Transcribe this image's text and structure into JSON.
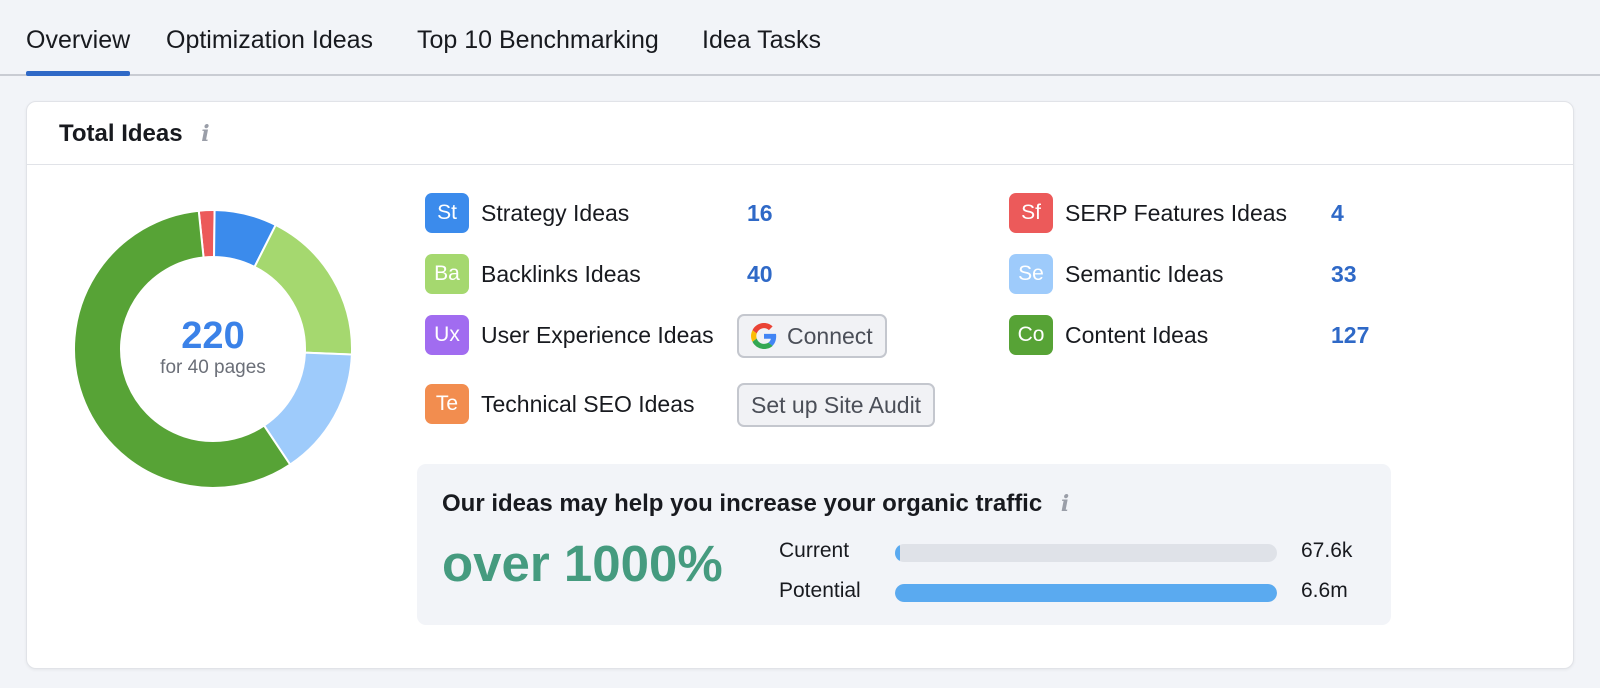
{
  "tabs": [
    {
      "label": "Overview",
      "active": true
    },
    {
      "label": "Optimization Ideas",
      "active": false
    },
    {
      "label": "Top 10 Benchmarking",
      "active": false
    },
    {
      "label": "Idea Tasks",
      "active": false
    }
  ],
  "card": {
    "title": "Total Ideas",
    "info_icon": "i"
  },
  "donut": {
    "total": "220",
    "subtitle": "for 40 pages"
  },
  "chart_data": {
    "type": "pie",
    "categories": [
      "Strategy Ideas",
      "Backlinks Ideas",
      "Semantic Ideas",
      "Content Ideas",
      "SERP Features Ideas"
    ],
    "values": [
      16,
      40,
      33,
      127,
      4
    ],
    "colors": [
      "#3b8bec",
      "#a5d86f",
      "#9ecbfb",
      "#57a336",
      "#ec5a5a"
    ],
    "total": 220
  },
  "ideas": [
    {
      "abbr": "St",
      "label": "Strategy Ideas",
      "count": "16",
      "color": "#3b8bec"
    },
    {
      "abbr": "Ba",
      "label": "Backlinks Ideas",
      "count": "40",
      "color": "#a5d86f"
    },
    {
      "abbr": "Ux",
      "label": "User Experience Ideas",
      "color": "#a16cf0",
      "button": "Connect",
      "button_icon": "google-icon"
    },
    {
      "abbr": "Te",
      "label": "Technical SEO Ideas",
      "color": "#f28d4f",
      "button": "Set up Site Audit"
    },
    {
      "abbr": "Sf",
      "label": "SERP Features Ideas",
      "count": "4",
      "color": "#ec5a5a"
    },
    {
      "abbr": "Se",
      "label": "Semantic Ideas",
      "count": "33",
      "color": "#9ecbfb"
    },
    {
      "abbr": "Co",
      "label": "Content Ideas",
      "count": "127",
      "color": "#57a336"
    }
  ],
  "traffic": {
    "title": "Our ideas may help you increase your organic traffic",
    "info_icon": "i",
    "headline": "over 1000%",
    "bars": [
      {
        "label": "Current",
        "value": "67.6k",
        "fill": 0.01,
        "color": "#5aaaf0"
      },
      {
        "label": "Potential",
        "value": "6.6m",
        "fill": 1.0,
        "color": "#5aaaf0"
      }
    ]
  }
}
